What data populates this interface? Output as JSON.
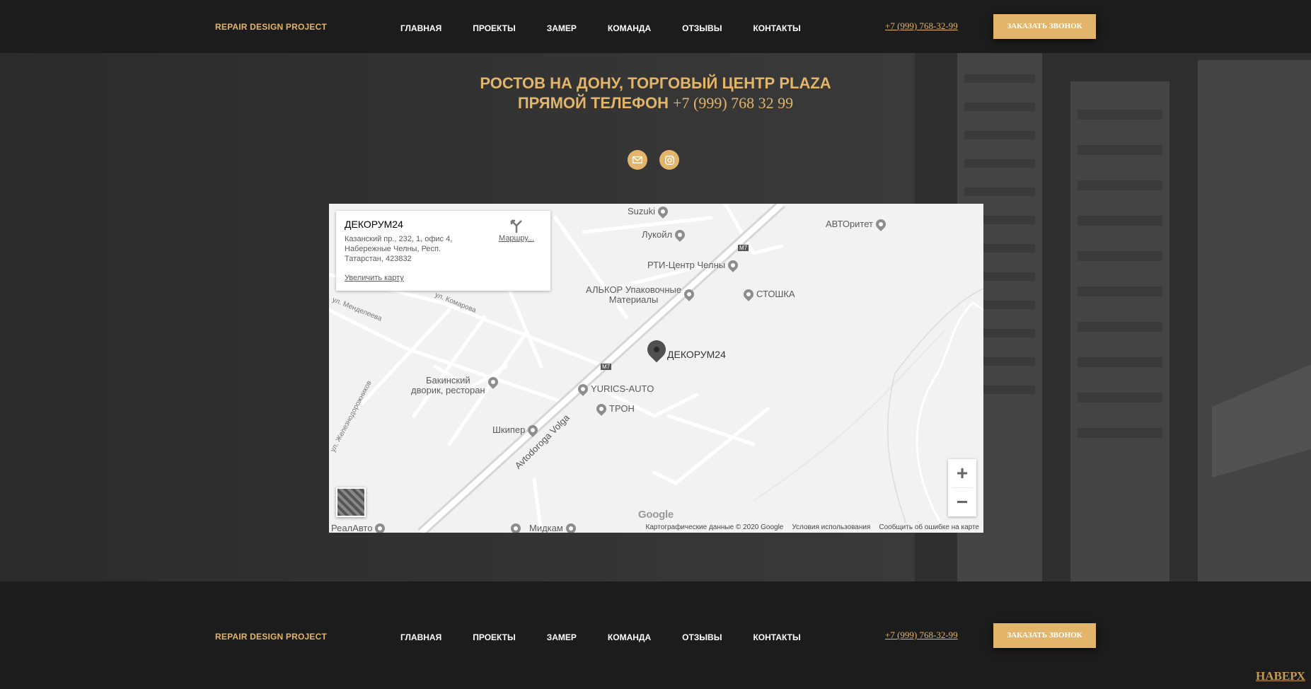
{
  "header": {
    "logo": "REPAIR DESIGN PROJECT",
    "nav": [
      "ГЛАВНАЯ",
      "ПРОЕКТЫ",
      "ЗАМЕР",
      "КОМАНДА",
      "ОТЗЫВЫ",
      "КОНТАКТЫ"
    ],
    "phone": "+7 (999) 768-32-99",
    "cta": "ЗАКАЗАТЬ ЗВОНОК"
  },
  "contacts": {
    "line1": "РОСТОВ НА ДОНУ, ТОРГОВЫЙ ЦЕНТР PLAZA",
    "line2_label": "ПРЯМОЙ ТЕЛЕФОН",
    "line2_phone": "+7 (999) 768 32 99",
    "social": [
      {
        "icon": "mail-icon"
      },
      {
        "icon": "instagram-icon"
      }
    ]
  },
  "map": {
    "info": {
      "name": "ДЕКОРУМ24",
      "address": "Казанский пр., 232, 1, офис 4, Набережные Челны, Респ. Татарстан, 423832",
      "zoom_link": "Увеличить карту",
      "route": "Маршру..."
    },
    "marker_label": "ДЕКОРУМ24",
    "pois": [
      "Suzuki",
      "Лукойл",
      "АВТОритет",
      "РТИ-Центр Челны",
      "АЛЬКОР Упаковочные",
      "Материалы",
      "СТОШКА",
      "Бакинский",
      "дворик, ресторан",
      "YURICS-AUTO",
      "ТРОН",
      "Шкипер",
      "Мидкам",
      "РеалАвто"
    ],
    "streets": [
      "ул. Менделеева",
      "ул. Комарова",
      "ул. Железнодорожников",
      "Avtodoroga Volga",
      "M7",
      "M7"
    ],
    "zoom_in": "+",
    "zoom_out": "−",
    "google": "Google",
    "attribution": [
      "Картографические данные © 2020 Google",
      "Условия использования",
      "Сообщить об ошибке на карте"
    ]
  },
  "footer": {
    "logo": "REPAIR DESIGN PROJECT",
    "nav": [
      "ГЛАВНАЯ",
      "ПРОЕКТЫ",
      "ЗАМЕР",
      "КОМАНДА",
      "ОТЗЫВЫ",
      "КОНТАКТЫ"
    ],
    "phone": "+7 (999) 768-32-99",
    "cta": "ЗАКАЗАТЬ ЗВОНОК"
  },
  "to_top": "НАВЕРХ",
  "colors": {
    "accent": "#e2b56a",
    "dark": "#1c1c1c"
  }
}
